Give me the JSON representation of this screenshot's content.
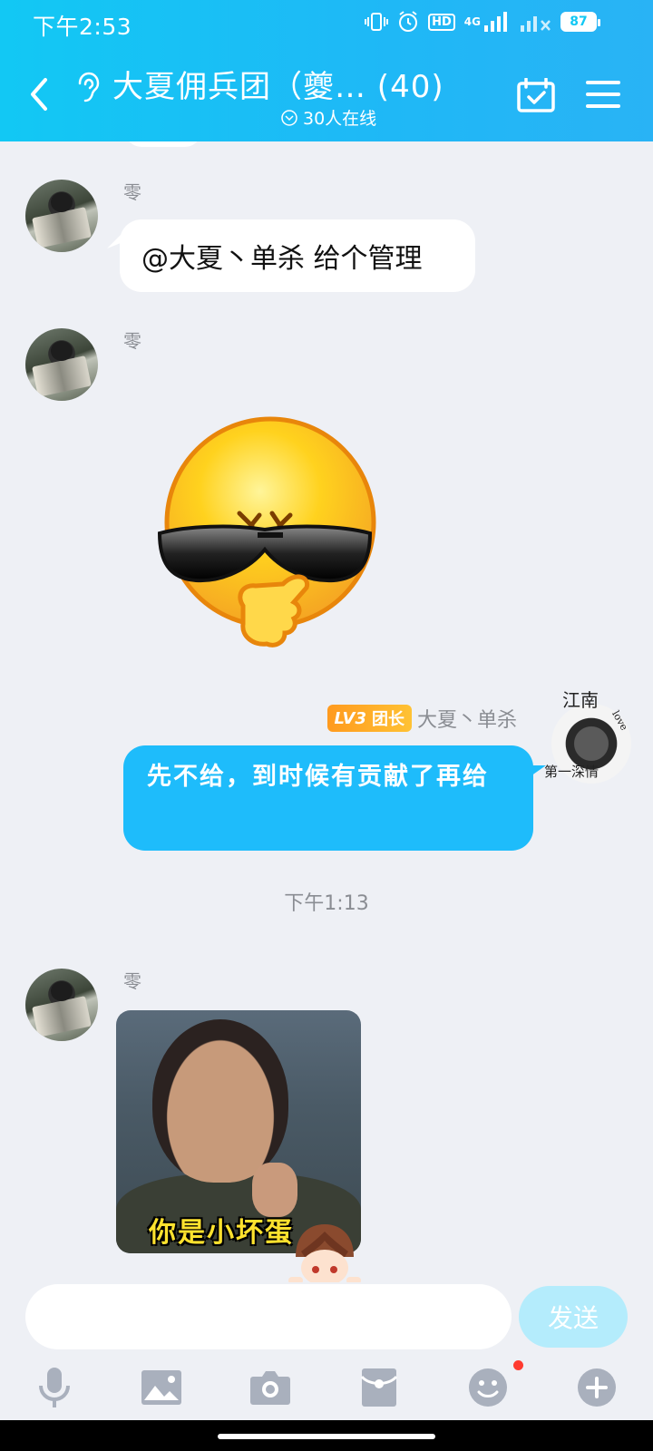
{
  "status_bar": {
    "time": "下午2:53",
    "network": "4G",
    "hd": "HD",
    "battery": "87"
  },
  "header": {
    "title": "大夏佣兵团（夔… (40)",
    "online_text": "30人在线"
  },
  "messages": [
    {
      "sender": "零",
      "text": "@大夏丶单杀 给个管理"
    },
    {
      "sender": "零",
      "sticker": "sunglasses-emoji"
    },
    {
      "sender": "大夏丶单杀",
      "level": "LV3",
      "role": "团长",
      "text": "先不给，到时候有贡献了再给"
    },
    {
      "sender": "零",
      "image_caption": "你是小坏蛋"
    }
  ],
  "timestamp": "下午1:13",
  "self_avatar_text": {
    "top": "江南",
    "bottom": "第一深情",
    "side": "love"
  },
  "input": {
    "placeholder": "",
    "send_label": "发送"
  },
  "toolbar": [
    "mic-icon",
    "image-icon",
    "camera-icon",
    "red-packet-icon",
    "emoji-icon",
    "plus-icon"
  ],
  "colors": {
    "header_gradient_start": "#12c8f4",
    "header_gradient_end": "#29b3f5",
    "self_bubble": "#1ebcfb",
    "send_disabled": "#b4ecfc",
    "badge": "#ffae28"
  }
}
